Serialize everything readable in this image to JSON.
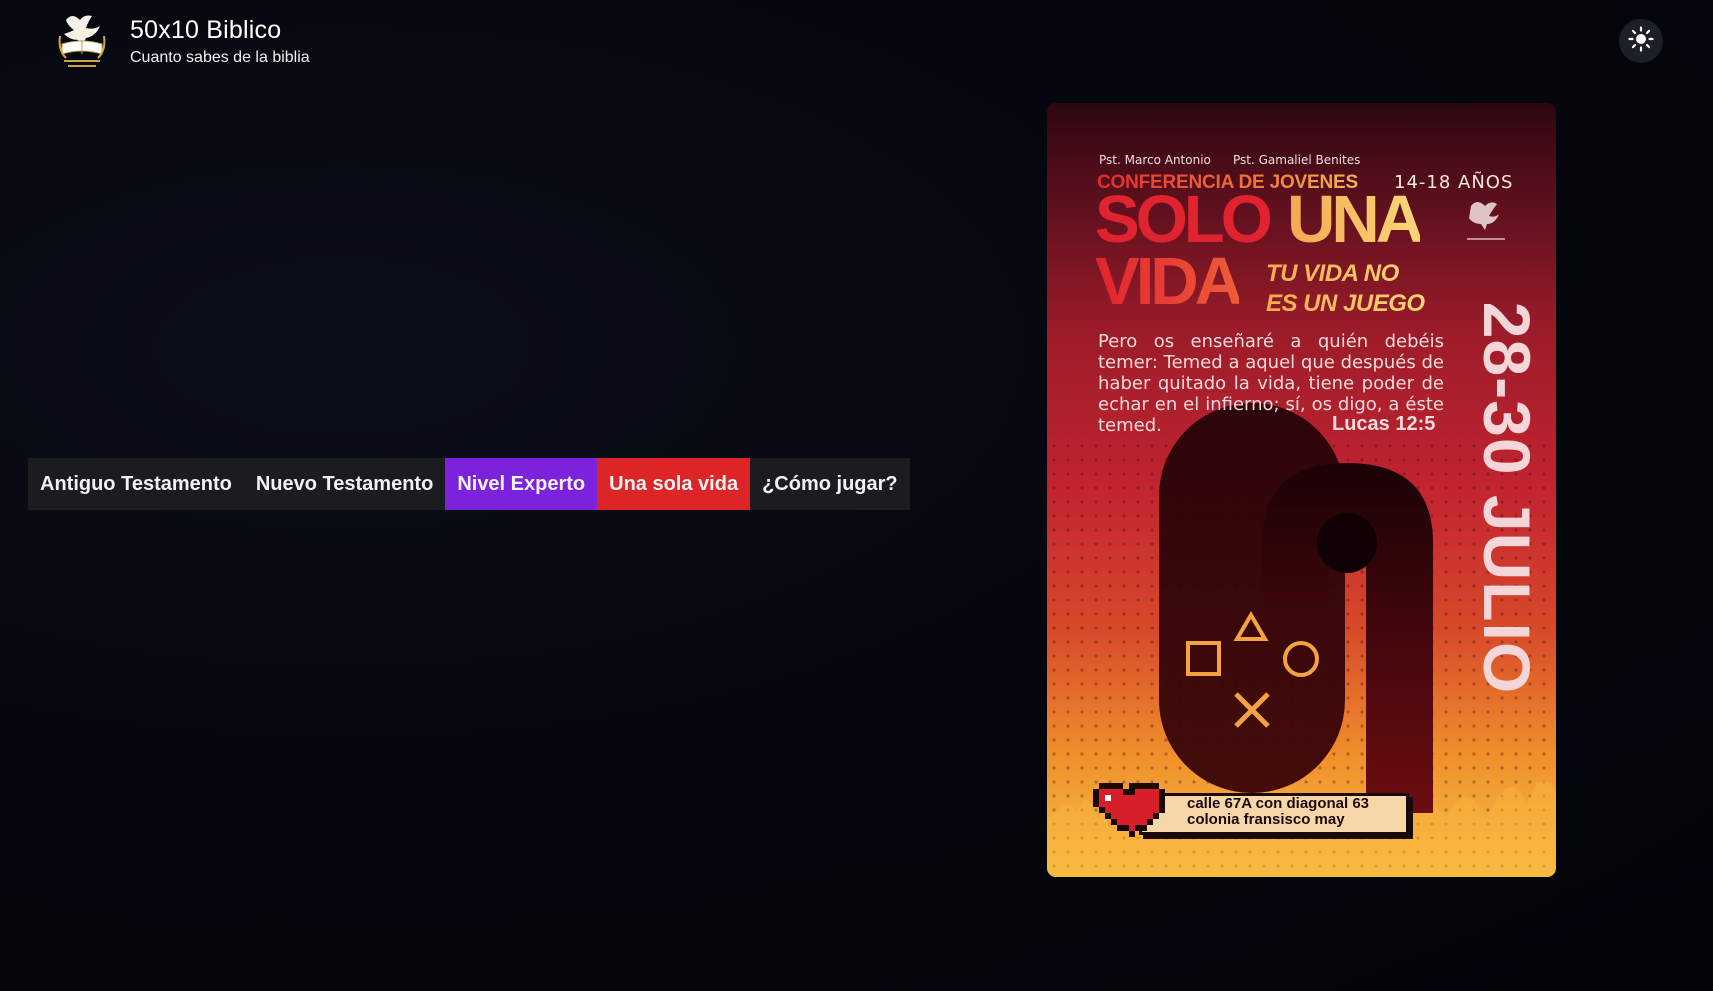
{
  "header": {
    "title": "50x10 Biblico",
    "subtitle": "Cuanto sabes de la biblia",
    "theme_toggle_icon": "sun-icon"
  },
  "tabs": [
    {
      "label": "Antiguo Testamento",
      "color": "#1b1c20"
    },
    {
      "label": "Nuevo Testamento",
      "color": "#1b1c20"
    },
    {
      "label": "Nivel Experto",
      "color": "#7c22dc"
    },
    {
      "label": "Una sola vida",
      "color": "#dd2528"
    },
    {
      "label": "¿Cómo jugar?",
      "color": "#1b1c20"
    }
  ],
  "poster": {
    "pastor_1": "Pst. Marco Antonio",
    "pastor_2": "Pst. Gamaliel Benites",
    "conference": "CONFERENCIA DE JOVENES",
    "ages": "14-18 AÑOS",
    "headline_1": "SOLO",
    "headline_2": "UNA",
    "headline_3": "VIDA",
    "tagline_1": "TU VIDA NO",
    "tagline_2": "ES UN JUEGO",
    "verse": "Pero os enseñaré a quién debéis temer: Temed a aquel que después de haber quitado la vida, tiene poder de echar en el infierno; sí, os digo, a éste temed.",
    "verse_ref": "Lucas 12:5",
    "dates": "28-30 JULIO",
    "address_1": "calle 67A con diagonal 63",
    "address_2": "colonia fransisco may"
  },
  "colors": {
    "background": "#03050c",
    "accent_purple": "#7c22dc",
    "accent_red": "#dd2528",
    "tab_dark": "#1b1c20"
  }
}
